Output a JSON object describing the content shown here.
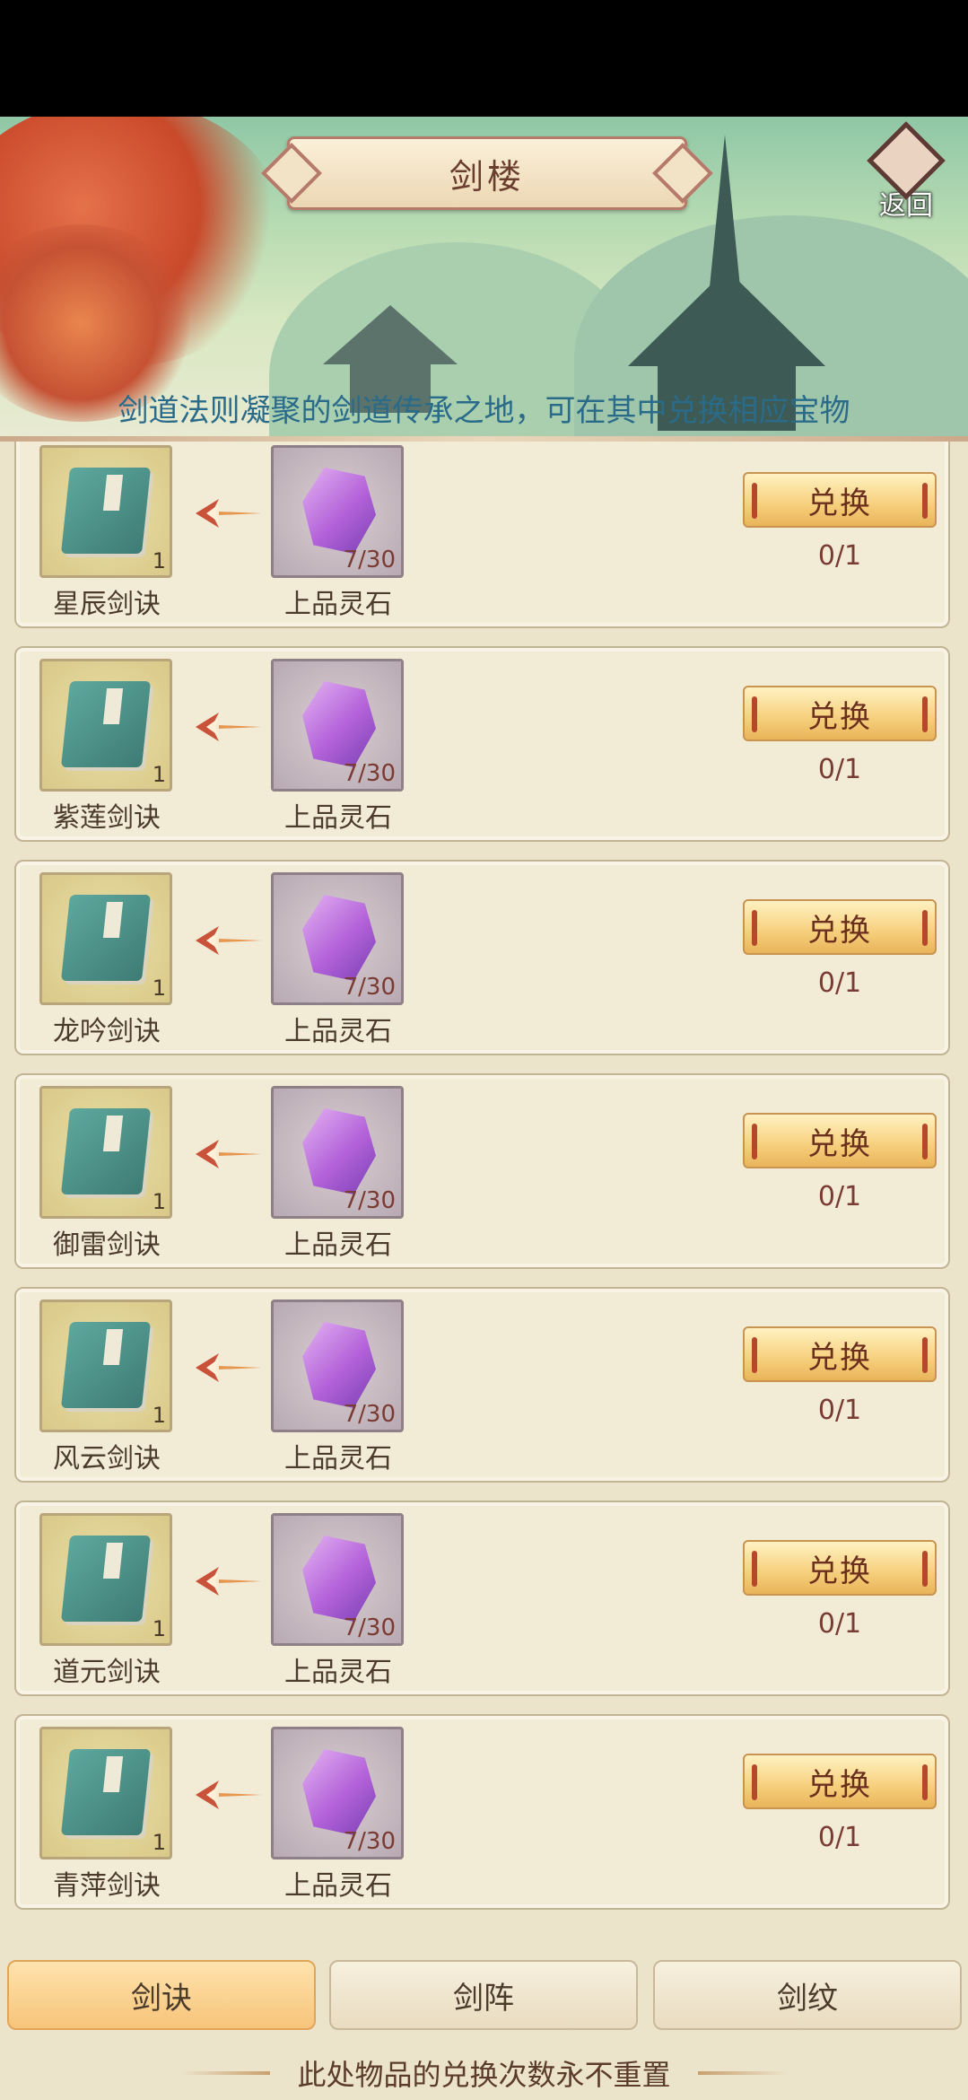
{
  "header": {
    "title": "剑楼",
    "back_label": "返回",
    "description": "剑道法则凝聚的剑道传承之地，可在其中兑换相应宝物"
  },
  "exchange_items": [
    {
      "reward_name": "星辰剑诀",
      "reward_count": "1",
      "cost_name": "上品灵石",
      "cost_progress": "7/30",
      "button_label": "兑换",
      "limit": "0/1"
    },
    {
      "reward_name": "紫莲剑诀",
      "reward_count": "1",
      "cost_name": "上品灵石",
      "cost_progress": "7/30",
      "button_label": "兑换",
      "limit": "0/1"
    },
    {
      "reward_name": "龙吟剑诀",
      "reward_count": "1",
      "cost_name": "上品灵石",
      "cost_progress": "7/30",
      "button_label": "兑换",
      "limit": "0/1"
    },
    {
      "reward_name": "御雷剑诀",
      "reward_count": "1",
      "cost_name": "上品灵石",
      "cost_progress": "7/30",
      "button_label": "兑换",
      "limit": "0/1"
    },
    {
      "reward_name": "风云剑诀",
      "reward_count": "1",
      "cost_name": "上品灵石",
      "cost_progress": "7/30",
      "button_label": "兑换",
      "limit": "0/1"
    },
    {
      "reward_name": "道元剑诀",
      "reward_count": "1",
      "cost_name": "上品灵石",
      "cost_progress": "7/30",
      "button_label": "兑换",
      "limit": "0/1"
    },
    {
      "reward_name": "青萍剑诀",
      "reward_count": "1",
      "cost_name": "上品灵石",
      "cost_progress": "7/30",
      "button_label": "兑换",
      "limit": "0/1"
    }
  ],
  "tabs": [
    {
      "label": "剑诀",
      "active": true
    },
    {
      "label": "剑阵",
      "active": false
    },
    {
      "label": "剑纹",
      "active": false
    }
  ],
  "footer": {
    "note": "此处物品的兑换次数永不重置"
  },
  "icons": {
    "reward": "sword-manual-book-icon",
    "cost": "purple-spirit-stone-icon",
    "arrow": "exchange-arrow-icon",
    "back": "return-diamond-icon"
  },
  "colors": {
    "accent": "#f7c47a",
    "text_brown": "#4b3b2b",
    "desc_blue": "#2a6b8a"
  }
}
